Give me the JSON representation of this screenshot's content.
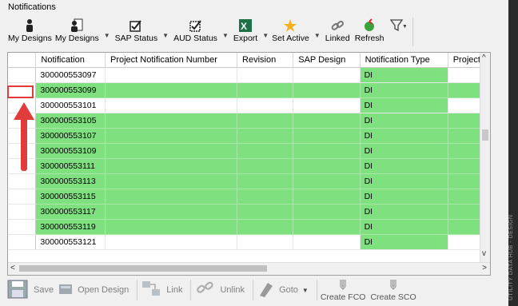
{
  "panel_title": "Notifications",
  "toolbar": {
    "my_designs_1": "My Designs",
    "my_designs_2": "My Designs",
    "sap_status": "SAP Status",
    "aud_status": "AUD Status",
    "export": "Export",
    "set_active": "Set Active",
    "linked": "Linked",
    "refresh": "Refresh"
  },
  "grid": {
    "columns": [
      "Notification",
      "Project Notification Number",
      "Revision",
      "SAP Design",
      "Notification Type",
      "Project N"
    ],
    "rows": [
      {
        "notification": "300000553097",
        "type": "DI",
        "green": false
      },
      {
        "notification": "300000553099",
        "type": "DI",
        "green": true
      },
      {
        "notification": "300000553101",
        "type": "DI",
        "green": false
      },
      {
        "notification": "300000553105",
        "type": "DI",
        "green": true
      },
      {
        "notification": "300000553107",
        "type": "DI",
        "green": true
      },
      {
        "notification": "300000553109",
        "type": "DI",
        "green": true
      },
      {
        "notification": "300000553111",
        "type": "DI",
        "green": true
      },
      {
        "notification": "300000553113",
        "type": "DI",
        "green": true
      },
      {
        "notification": "300000553115",
        "type": "DI",
        "green": true
      },
      {
        "notification": "300000553117",
        "type": "DI",
        "green": true
      },
      {
        "notification": "300000553119",
        "type": "DI",
        "green": true
      },
      {
        "notification": "300000553121",
        "type": "DI",
        "green": false
      }
    ]
  },
  "bottombar": {
    "save": "Save",
    "open_design": "Open Design",
    "link": "Link",
    "unlink": "Unlink",
    "goto": "Goto",
    "create_fco": "Create FCO",
    "create_sco": "Create SCO"
  },
  "side_panel_text": "UTILITY DATA HUB - DESIGN",
  "colors": {
    "green_row": "#7fe07f",
    "annotation_red": "#e23b3b"
  }
}
